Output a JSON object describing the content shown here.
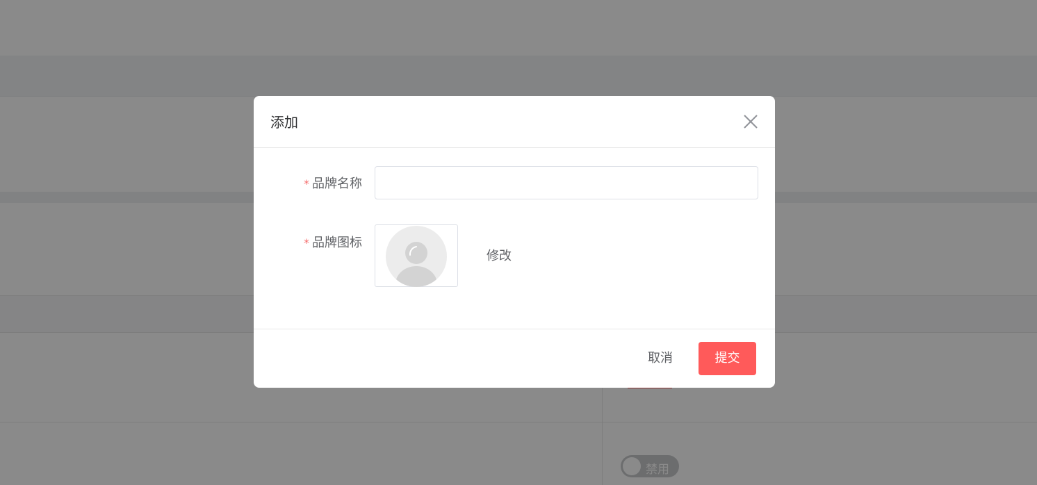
{
  "dialog": {
    "title": "添加",
    "close_icon": "close-icon",
    "fields": [
      {
        "label": "品牌名称",
        "required": true,
        "value": "",
        "placeholder": ""
      },
      {
        "label": "品牌图标",
        "required": true,
        "avatar_icon": "user-avatar-placeholder-icon",
        "action_label": "修改"
      }
    ],
    "cancel_label": "取消",
    "submit_label": "提交"
  },
  "background": {
    "status_switch_label": "禁用"
  },
  "colors": {
    "primary": "#ff5a5a",
    "required_star": "#f56c6c",
    "overlay": "rgba(0,0,0,0.46)"
  }
}
